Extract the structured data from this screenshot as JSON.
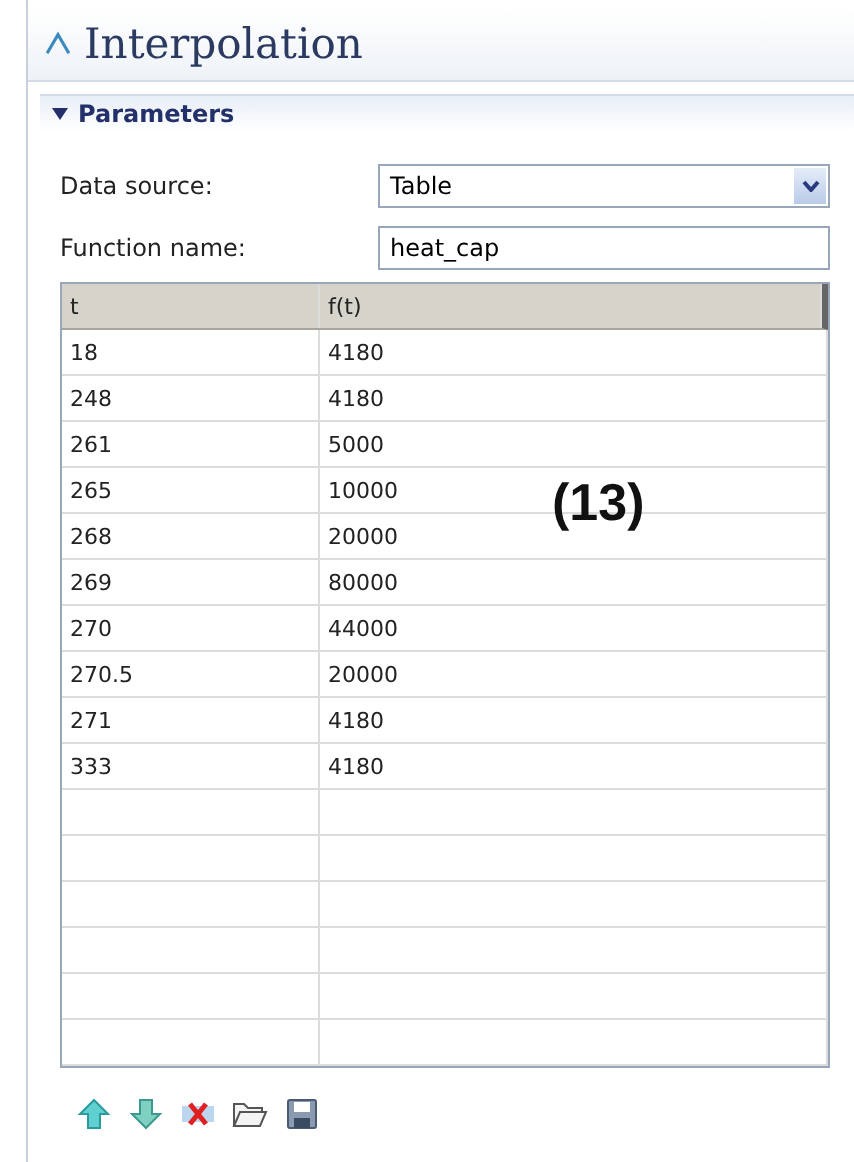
{
  "title": "Interpolation",
  "section": {
    "label": "Parameters",
    "expanded": true
  },
  "fields": [
    {
      "kind": "select",
      "label": "Data source:",
      "value": "Table"
    },
    {
      "kind": "text",
      "label": "Function name:",
      "value": "heat_cap"
    }
  ],
  "table": {
    "columns": [
      "t",
      "f(t)"
    ],
    "rows": [
      [
        "18",
        "4180"
      ],
      [
        "248",
        "4180"
      ],
      [
        "261",
        "5000"
      ],
      [
        "265",
        "10000"
      ],
      [
        "268",
        "20000"
      ],
      [
        "269",
        "80000"
      ],
      [
        "270",
        "44000"
      ],
      [
        "270.5",
        "20000"
      ],
      [
        "271",
        "4180"
      ],
      [
        "333",
        "4180"
      ]
    ]
  },
  "annotation": "(13)"
}
